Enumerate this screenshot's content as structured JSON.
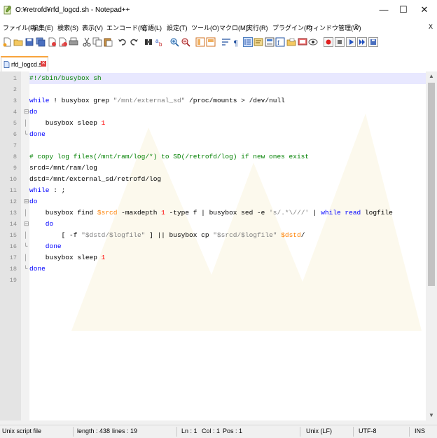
{
  "window": {
    "title": "O:¥retrofd¥rfd_logcd.sh - Notepad++",
    "minimize_glyph": "—",
    "maximize_glyph": "☐",
    "close_glyph": "✕"
  },
  "menu": {
    "items": [
      "ファイル(F)",
      "編集(E)",
      "検索(S)",
      "表示(V)",
      "エンコード(N)",
      "言語(L)",
      "設定(T)",
      "ツール(O)",
      "マクロ(M)",
      "実行(R)",
      "プラグイン(P)",
      "ウィンドウ管理(W)",
      "?"
    ],
    "close_label": "X"
  },
  "toolbar": {
    "icons": [
      "new-file-icon",
      "open-file-icon",
      "save-icon",
      "save-all-icon",
      "close-icon",
      "close-all-icon",
      "print-icon",
      "cut-icon",
      "copy-icon",
      "paste-icon",
      "undo-icon",
      "redo-icon",
      "find-icon",
      "replace-icon",
      "zoom-in-icon",
      "zoom-out-icon",
      "sync-vertical-icon",
      "sync-horizontal-icon",
      "word-wrap-icon",
      "show-all-chars-icon",
      "indent-guide-icon",
      "lang-udl-icon",
      "doc-map-icon",
      "function-list-icon",
      "folder-workspace-icon",
      "monitor-icon",
      "record-macro-icon",
      "stop-macro-icon",
      "play-macro-icon",
      "run-macro-multiple-icon",
      "save-macro-icon"
    ]
  },
  "tab": {
    "label": "rfd_logcd.sh",
    "icon": "document-icon"
  },
  "editor": {
    "current_line": 1,
    "lines": [
      {
        "n": "1",
        "fold": "",
        "tokens": [
          {
            "t": "#!/sbin/busybox sh",
            "c": "comment"
          }
        ]
      },
      {
        "n": "2",
        "fold": "",
        "tokens": []
      },
      {
        "n": "3",
        "fold": "",
        "tokens": [
          {
            "t": "while",
            "c": "kw"
          },
          {
            "t": " ! busybox grep ",
            "c": "plain"
          },
          {
            "t": "\"/mnt/external_sd\"",
            "c": "string"
          },
          {
            "t": " /proc/mounts > /dev/null",
            "c": "plain"
          }
        ]
      },
      {
        "n": "4",
        "fold": "⊟",
        "tokens": [
          {
            "t": "do",
            "c": "kw"
          }
        ]
      },
      {
        "n": "5",
        "fold": "│",
        "tokens": [
          {
            "t": "    busybox sleep ",
            "c": "plain"
          },
          {
            "t": "1",
            "c": "number"
          }
        ]
      },
      {
        "n": "6",
        "fold": "└",
        "tokens": [
          {
            "t": "done",
            "c": "kw"
          }
        ]
      },
      {
        "n": "7",
        "fold": "",
        "tokens": []
      },
      {
        "n": "8",
        "fold": "",
        "tokens": [
          {
            "t": "# copy log files(/mnt/ram/log/*) to SD(/retrofd/log) if new ones exist",
            "c": "comment"
          }
        ]
      },
      {
        "n": "9",
        "fold": "",
        "tokens": [
          {
            "t": "srcd=/mnt/ram/log",
            "c": "plain"
          }
        ]
      },
      {
        "n": "10",
        "fold": "",
        "tokens": [
          {
            "t": "dstd=/mnt/external_sd/retrofd/log",
            "c": "plain"
          }
        ]
      },
      {
        "n": "11",
        "fold": "",
        "tokens": [
          {
            "t": "while",
            "c": "kw"
          },
          {
            "t": " : ;",
            "c": "plain"
          }
        ]
      },
      {
        "n": "12",
        "fold": "⊟",
        "tokens": [
          {
            "t": "do",
            "c": "kw"
          }
        ]
      },
      {
        "n": "13",
        "fold": "│",
        "tokens": [
          {
            "t": "    busybox find ",
            "c": "plain"
          },
          {
            "t": "$srcd",
            "c": "var"
          },
          {
            "t": " -maxdepth ",
            "c": "plain"
          },
          {
            "t": "1",
            "c": "number"
          },
          {
            "t": " -type f | busybox sed -e ",
            "c": "plain"
          },
          {
            "t": "'s/.*\\///'",
            "c": "string"
          },
          {
            "t": " | ",
            "c": "plain"
          },
          {
            "t": "while read",
            "c": "kw"
          },
          {
            "t": " logfile",
            "c": "plain"
          }
        ]
      },
      {
        "n": "14",
        "fold": "⊟",
        "tokens": [
          {
            "t": "    do",
            "c": "kw"
          }
        ]
      },
      {
        "n": "15",
        "fold": "│",
        "tokens": [
          {
            "t": "        [ -f ",
            "c": "plain"
          },
          {
            "t": "\"$dstd/$logfile\"",
            "c": "string"
          },
          {
            "t": " ] || busybox cp ",
            "c": "plain"
          },
          {
            "t": "\"$srcd/$logfile\"",
            "c": "string"
          },
          {
            "t": " ",
            "c": "plain"
          },
          {
            "t": "$dstd",
            "c": "var"
          },
          {
            "t": "/",
            "c": "plain"
          }
        ]
      },
      {
        "n": "16",
        "fold": "└",
        "tokens": [
          {
            "t": "    done",
            "c": "kw"
          }
        ]
      },
      {
        "n": "17",
        "fold": "│",
        "tokens": [
          {
            "t": "    busybox sleep ",
            "c": "plain"
          },
          {
            "t": "1",
            "c": "number"
          }
        ]
      },
      {
        "n": "18",
        "fold": "└",
        "tokens": [
          {
            "t": "done",
            "c": "kw"
          }
        ]
      },
      {
        "n": "19",
        "fold": "",
        "tokens": []
      }
    ]
  },
  "status": {
    "file_type": "Unix script file",
    "length": "length : 438",
    "lines": "lines : 19",
    "ln": "Ln : 1",
    "col": "Col : 1",
    "pos": "Pos : 1",
    "eol": "Unix (LF)",
    "encoding": "UTF-8",
    "mode": "INS"
  },
  "colors": {
    "keyword": "#0000ff",
    "comment": "#008000",
    "string": "#808080",
    "number": "#ff0000",
    "variable": "#ff8000",
    "current_line": "#e8e8ff",
    "tab_accent": "#f8a43c"
  }
}
